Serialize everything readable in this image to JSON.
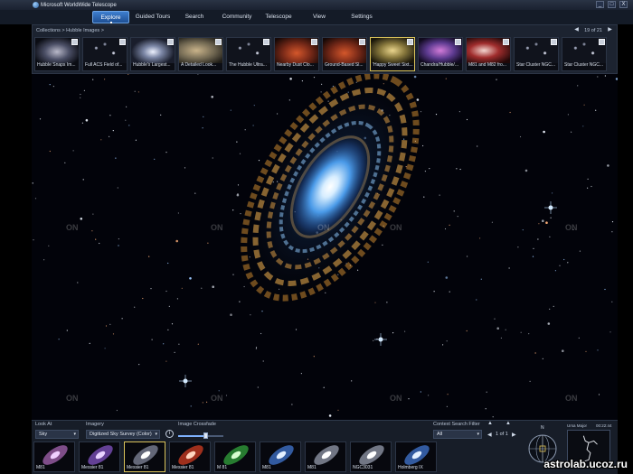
{
  "app": {
    "title": "Microsoft WorldWide Telescope"
  },
  "window_buttons": {
    "minimize": "_",
    "maximize": "□",
    "close": "X"
  },
  "menu": {
    "tabs": [
      {
        "label": "Explore",
        "active": true
      },
      {
        "label": "Guided Tours"
      },
      {
        "label": "Search"
      },
      {
        "label": "Community"
      },
      {
        "label": "Telescope"
      },
      {
        "label": "View"
      },
      {
        "label": "Settings"
      }
    ]
  },
  "explore": {
    "breadcrumb": "Collections  >  Hubble Images  >",
    "page": "19 of 21",
    "prev": "◀",
    "next": "▶",
    "thumbnails": [
      {
        "label": "Hubble Snaps Im...",
        "palette": "grey"
      },
      {
        "label": "Full ACS Field of...",
        "palette": "stars"
      },
      {
        "label": "Hubble's Largest...",
        "palette": "spiral"
      },
      {
        "label": "A Detailed Look...",
        "palette": "tan"
      },
      {
        "label": "The Hubble Ultra...",
        "palette": "stars"
      },
      {
        "label": "Nearby Dust Clo...",
        "palette": "nebula-red"
      },
      {
        "label": "Ground-Based Sl...",
        "palette": "nebula-red"
      },
      {
        "label": "'Happy Sweet Sixt...",
        "palette": "yellow",
        "selected": true
      },
      {
        "label": "Chandra/Hubble/...",
        "palette": "purple"
      },
      {
        "label": "M81 and M82 fro...",
        "palette": "red-white"
      },
      {
        "label": "Star Cluster NGC...",
        "palette": "stars"
      },
      {
        "label": "Star Cluster NGC...",
        "palette": "stars"
      }
    ]
  },
  "sky": {
    "watermarks": [
      "ON",
      "ON",
      "ON",
      "ON",
      "ON",
      "ON",
      "ON",
      "ON",
      "ON"
    ]
  },
  "bottom": {
    "look_at_label": "Look At",
    "look_at_value": "Sky",
    "imagery_label": "Imagery",
    "imagery_value": "Digitized Sky Survey (Color)",
    "info": "i",
    "crossfade_label": "Image Crossfade",
    "crossfade_level": 0.6,
    "context_filter_label": "Context Search Filter",
    "context_filter_value": "All",
    "context_page": "1 of 1",
    "context_items": [
      {
        "label": "M81",
        "kind": "spiral-pink"
      },
      {
        "label": "Messier 81",
        "kind": "spiral-purple"
      },
      {
        "label": "Messier 81",
        "kind": "spiral-grey",
        "selected": true
      },
      {
        "label": "Messier 81",
        "kind": "spiral-red"
      },
      {
        "label": "M 81",
        "kind": "spiral-green"
      },
      {
        "label": "M81",
        "kind": "spiral-blue"
      },
      {
        "label": "M81",
        "kind": "spiral-white"
      },
      {
        "label": "NGC3031",
        "kind": "spiral-white"
      },
      {
        "label": "Holmberg IX",
        "kind": "spiral-blue"
      }
    ],
    "compass_label": "N",
    "constellation": "Ursa Major",
    "time": "00:22:44"
  },
  "watermark": "astrolab.ucoz.ru",
  "colors": {
    "accent": "#3e7fd0",
    "selected": "#d9c25a",
    "panel": "#1c2330"
  }
}
